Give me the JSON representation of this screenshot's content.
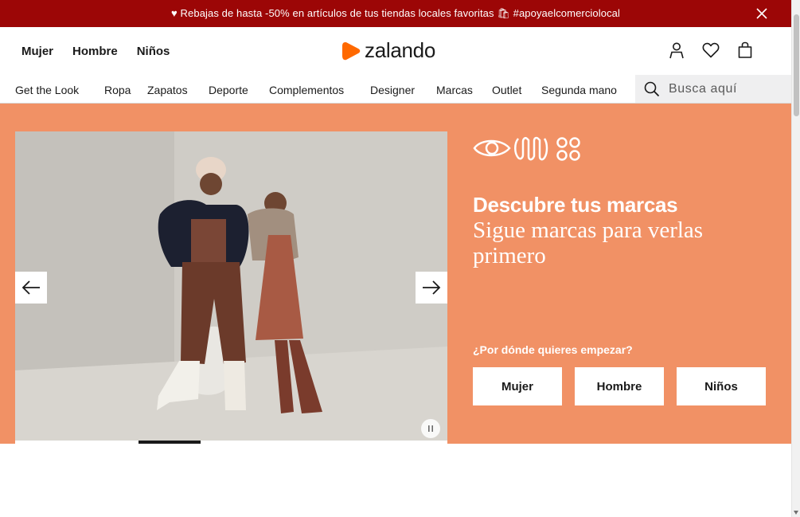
{
  "promo": {
    "text": "Rebajas de hasta -50% en artículos de tus tiendas locales favoritas",
    "hashtag": "#apoyaelcomerciolocal",
    "bg_color": "#9c0606"
  },
  "header": {
    "genders": [
      "Mujer",
      "Hombre",
      "Niños"
    ],
    "logo_text": "zalando",
    "logo_color": "#ff6900",
    "icons": [
      "user-icon",
      "heart-icon",
      "bag-icon"
    ]
  },
  "nav": {
    "items": [
      "Get the Look",
      "Ropa",
      "Zapatos",
      "Deporte",
      "Complementos",
      "Designer",
      "Marcas",
      "Outlet",
      "Segunda mano"
    ],
    "search_placeholder": "Busca aquí"
  },
  "hero": {
    "bg_color": "#f19165",
    "title": "Descubre tus marcas",
    "subtitle": "Sigue marcas para verlas primero",
    "question": "¿Por dónde quieres empezar?",
    "buttons": [
      "Mujer",
      "Hombre",
      "Niños"
    ],
    "carousel": {
      "slide_index": 3,
      "slide_count": 7
    }
  }
}
